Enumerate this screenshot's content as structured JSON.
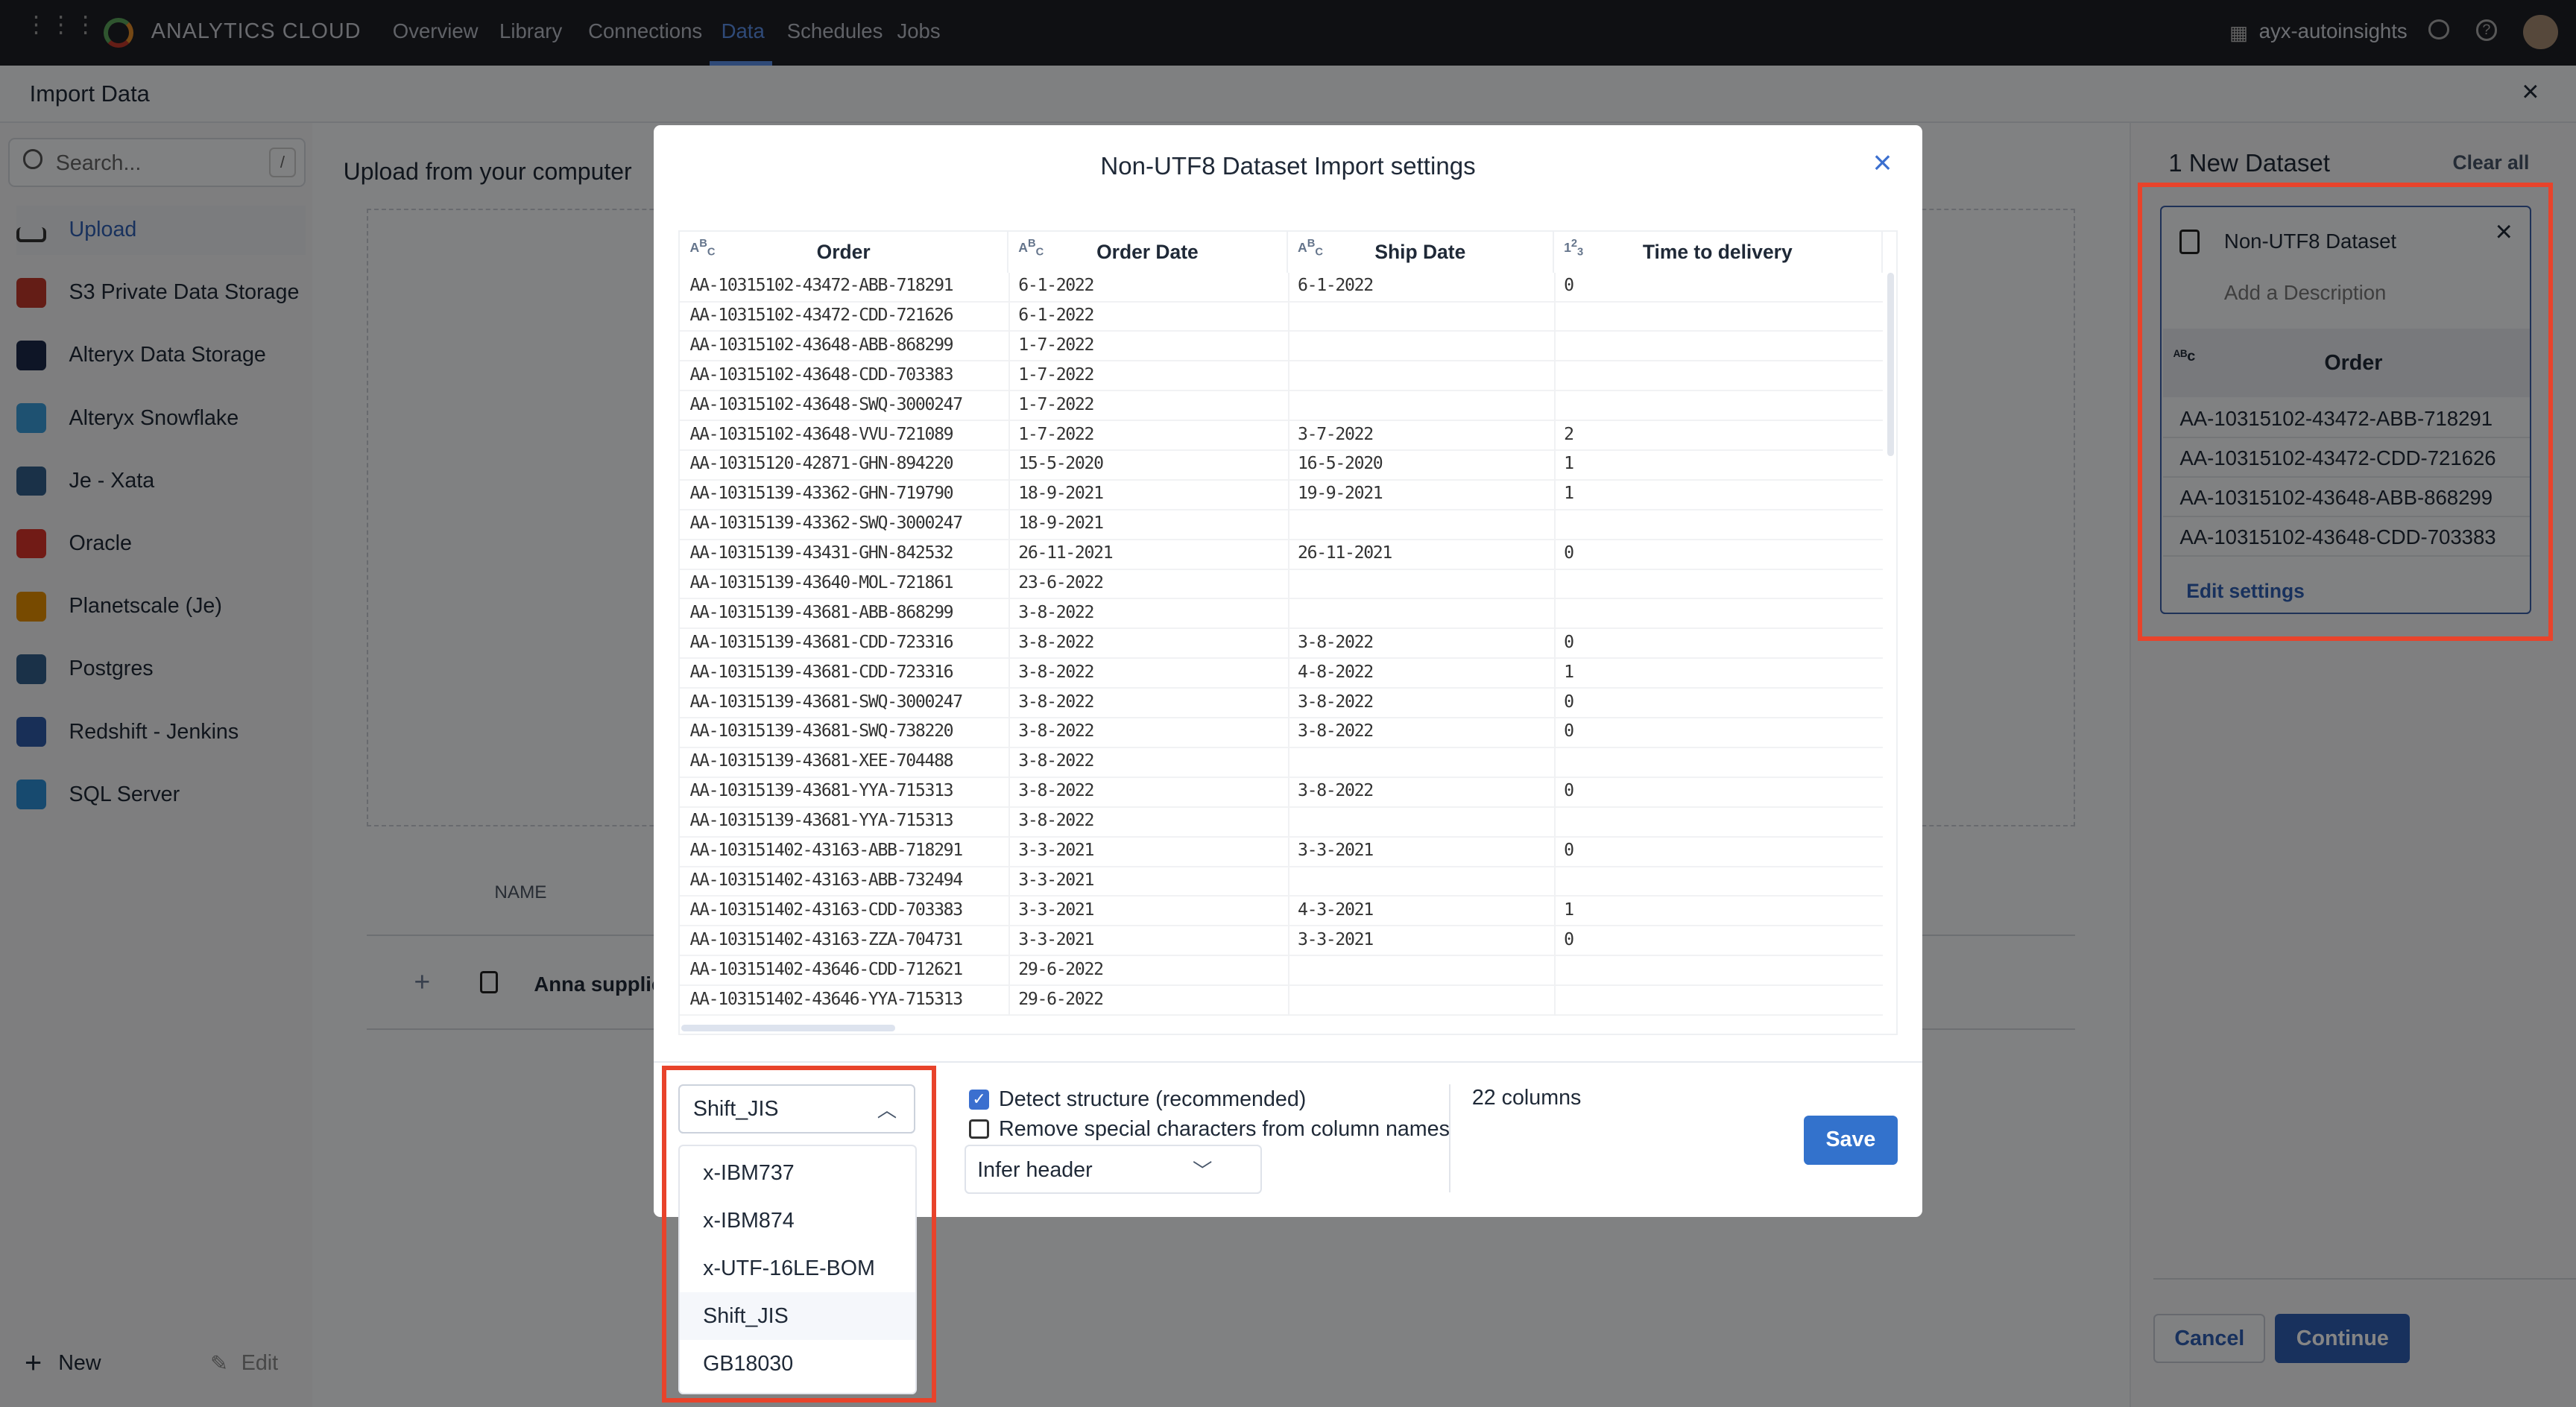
{
  "topbar": {
    "brand": "ANALYTICS CLOUD",
    "nav": [
      "Overview",
      "Library",
      "Connections",
      "Data",
      "Schedules",
      "Jobs"
    ],
    "active_nav": "Data",
    "workspace": "ayx-autoinsights"
  },
  "header": {
    "title": "Import Data"
  },
  "sidebar": {
    "search_placeholder": "Search...",
    "search_shortcut": "/",
    "items": [
      {
        "label": "Upload",
        "icon": "upload-icon",
        "color": "#2f5fb3"
      },
      {
        "label": "S3 Private Data Storage",
        "icon": "s3-icon",
        "color": "#c0392b"
      },
      {
        "label": "Alteryx Data Storage",
        "icon": "alteryx-icon",
        "color": "#1b2a4a"
      },
      {
        "label": "Alteryx Snowflake",
        "icon": "snowflake-icon",
        "color": "#3a9bd9"
      },
      {
        "label": "Je - Xata",
        "icon": "postgres-icon",
        "color": "#335f8a"
      },
      {
        "label": "Oracle",
        "icon": "oracle-icon",
        "color": "#d9342b"
      },
      {
        "label": "Planetscale (Je)",
        "icon": "mysql-icon",
        "color": "#e48e00"
      },
      {
        "label": "Postgres",
        "icon": "postgres-icon",
        "color": "#335f8a"
      },
      {
        "label": "Redshift - Jenkins",
        "icon": "redshift-icon",
        "color": "#2e5ba8"
      },
      {
        "label": "SQL Server",
        "icon": "windows-icon",
        "color": "#2d8fd5"
      }
    ],
    "new_label": "New",
    "edit_label": "Edit"
  },
  "main": {
    "upload_title": "Upload from your computer",
    "name_header": "NAME",
    "file_name": "Anna supplies"
  },
  "right_panel": {
    "title": "1 New Dataset",
    "clear_all": "Clear all",
    "card": {
      "name": "Non-UTF8 Dataset",
      "description_placeholder": "Add a Description",
      "column": "Order",
      "values": [
        "AA-10315102-43472-ABB-718291",
        "AA-10315102-43472-CDD-721626",
        "AA-10315102-43648-ABB-868299",
        "AA-10315102-43648-CDD-703383"
      ],
      "edit_settings": "Edit settings"
    },
    "cancel": "Cancel",
    "continue": "Continue"
  },
  "modal": {
    "title": "Non-UTF8 Dataset Import settings",
    "columns": [
      {
        "name": "Order",
        "type": "string"
      },
      {
        "name": "Order Date",
        "type": "string"
      },
      {
        "name": "Ship Date",
        "type": "string"
      },
      {
        "name": "Time to delivery",
        "type": "number"
      }
    ],
    "rows": [
      [
        "AA-10315102-43472-ABB-718291",
        "6-1-2022",
        "6-1-2022",
        "0"
      ],
      [
        "AA-10315102-43472-CDD-721626",
        "6-1-2022",
        "",
        ""
      ],
      [
        "AA-10315102-43648-ABB-868299",
        "1-7-2022",
        "",
        ""
      ],
      [
        "AA-10315102-43648-CDD-703383",
        "1-7-2022",
        "",
        ""
      ],
      [
        "AA-10315102-43648-SWQ-3000247",
        "1-7-2022",
        "",
        ""
      ],
      [
        "AA-10315102-43648-VVU-721089",
        "1-7-2022",
        "3-7-2022",
        "2"
      ],
      [
        "AA-10315120-42871-GHN-894220",
        "15-5-2020",
        "16-5-2020",
        "1"
      ],
      [
        "AA-10315139-43362-GHN-719790",
        "18-9-2021",
        "19-9-2021",
        "1"
      ],
      [
        "AA-10315139-43362-SWQ-3000247",
        "18-9-2021",
        "",
        ""
      ],
      [
        "AA-10315139-43431-GHN-842532",
        "26-11-2021",
        "26-11-2021",
        "0"
      ],
      [
        "AA-10315139-43640-MOL-721861",
        "23-6-2022",
        "",
        ""
      ],
      [
        "AA-10315139-43681-ABB-868299",
        "3-8-2022",
        "",
        ""
      ],
      [
        "AA-10315139-43681-CDD-723316",
        "3-8-2022",
        "3-8-2022",
        "0"
      ],
      [
        "AA-10315139-43681-CDD-723316",
        "3-8-2022",
        "4-8-2022",
        "1"
      ],
      [
        "AA-10315139-43681-SWQ-3000247",
        "3-8-2022",
        "3-8-2022",
        "0"
      ],
      [
        "AA-10315139-43681-SWQ-738220",
        "3-8-2022",
        "3-8-2022",
        "0"
      ],
      [
        "AA-10315139-43681-XEE-704488",
        "3-8-2022",
        "",
        ""
      ],
      [
        "AA-10315139-43681-YYA-715313",
        "3-8-2022",
        "3-8-2022",
        "0"
      ],
      [
        "AA-10315139-43681-YYA-715313",
        "3-8-2022",
        "",
        ""
      ],
      [
        "AA-103151402-43163-ABB-718291",
        "3-3-2021",
        "3-3-2021",
        "0"
      ],
      [
        "AA-103151402-43163-ABB-732494",
        "3-3-2021",
        "",
        ""
      ],
      [
        "AA-103151402-43163-CDD-703383",
        "3-3-2021",
        "4-3-2021",
        "1"
      ],
      [
        "AA-103151402-43163-ZZA-704731",
        "3-3-2021",
        "3-3-2021",
        "0"
      ],
      [
        "AA-103151402-43646-CDD-712621",
        "29-6-2022",
        "",
        ""
      ],
      [
        "AA-103151402-43646-YYA-715313",
        "29-6-2022",
        "",
        ""
      ]
    ],
    "encoding": {
      "selected": "Shift_JIS",
      "options": [
        "x-IBM737",
        "x-IBM874",
        "x-UTF-16LE-BOM",
        "Shift_JIS",
        "GB18030"
      ],
      "highlighted": "Shift_JIS"
    },
    "detect_structure": {
      "label": "Detect structure (recommended)",
      "checked": true
    },
    "remove_special": {
      "label": "Remove special characters from column names",
      "checked": false
    },
    "header_mode": "Infer header",
    "column_count": "22 columns",
    "save": "Save"
  },
  "colors": {
    "accent": "#2f6fd0",
    "highlight": "#e8432b"
  }
}
